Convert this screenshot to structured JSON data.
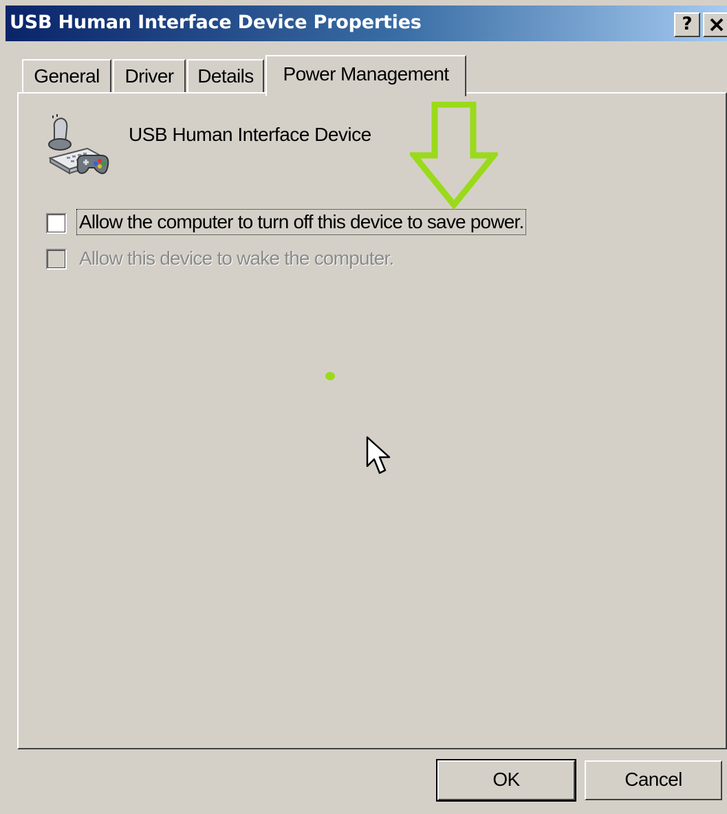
{
  "window": {
    "title": "USB Human Interface Device Properties",
    "help_label": "?",
    "close_label": "✕"
  },
  "tabs": [
    {
      "label": "General",
      "active": false
    },
    {
      "label": "Driver",
      "active": false
    },
    {
      "label": "Details",
      "active": false
    },
    {
      "label": "Power Management",
      "active": true
    }
  ],
  "device": {
    "name": "USB Human Interface Device",
    "icon": "hid-device-icon"
  },
  "options": [
    {
      "label": "Allow the computer to turn off this device to save power.",
      "checked": false,
      "enabled": true,
      "focused": true
    },
    {
      "label": "Allow this device to wake the computer.",
      "checked": false,
      "enabled": false
    }
  ],
  "buttons": {
    "ok_label": "OK",
    "cancel_label": "Cancel"
  },
  "colors": {
    "titlebar_start": "#0a246a",
    "titlebar_end": "#a6caf0",
    "dialog_face": "#d4d0c8",
    "annotation": "#9ada1a"
  }
}
